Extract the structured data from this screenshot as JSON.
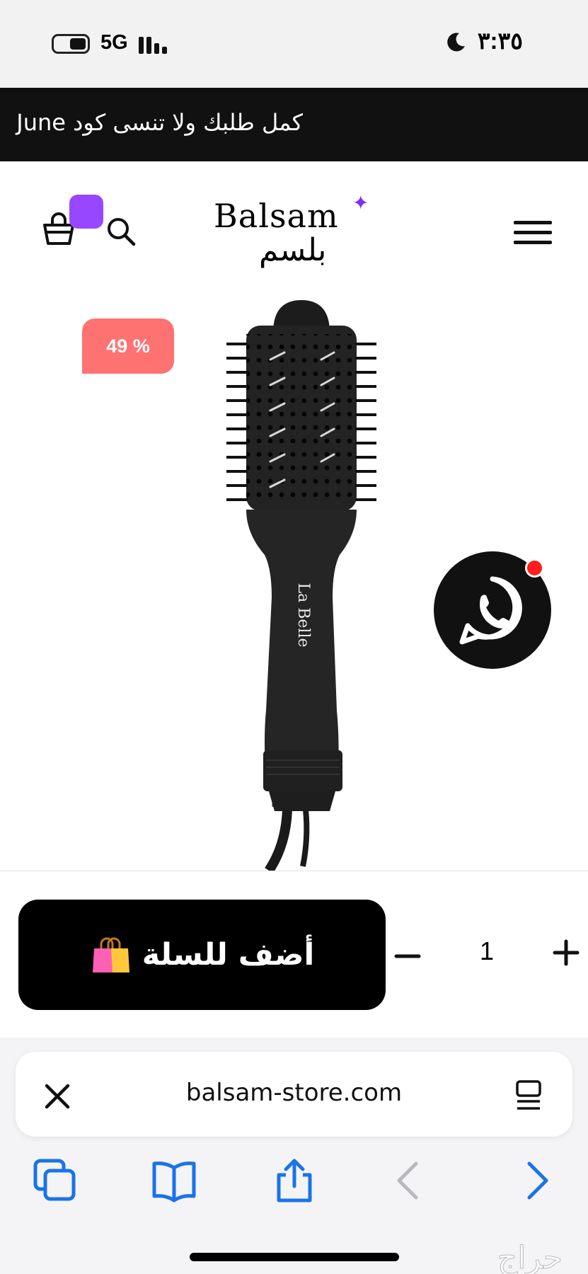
{
  "status_bar": {
    "network": "5G",
    "time": "٣:٣٥",
    "icons": [
      "battery-icon",
      "signal-icon",
      "moon-icon"
    ]
  },
  "announcement": {
    "text": "كمل طلبك ولا تنسى كود June"
  },
  "header": {
    "logo_latin": "Balsam",
    "logo_arabic": "بلسم",
    "icons": [
      "cart-icon",
      "search-icon",
      "menu-icon"
    ],
    "accent_color": "#9747ff"
  },
  "product": {
    "discount_badge": "49 %",
    "discount_color": "#ff7272",
    "image_brand_text": "La Belle",
    "image": "hair-dryer-brush"
  },
  "purchase": {
    "add_to_cart_label": "أضف للسلة",
    "quantity": "1",
    "icons": [
      "shopping-bag-icon",
      "minus-icon",
      "plus-icon"
    ]
  },
  "floating": {
    "icon": "whatsapp-icon",
    "notification_color": "#ff1c1c"
  },
  "browser": {
    "url": "balsam-store.com",
    "accent_color": "#1a73e8",
    "icons": [
      "close-icon",
      "reader-icon",
      "tabs-icon",
      "bookmarks-icon",
      "share-icon",
      "back-icon",
      "forward-icon"
    ]
  },
  "watermark": {
    "text": "حراج"
  }
}
